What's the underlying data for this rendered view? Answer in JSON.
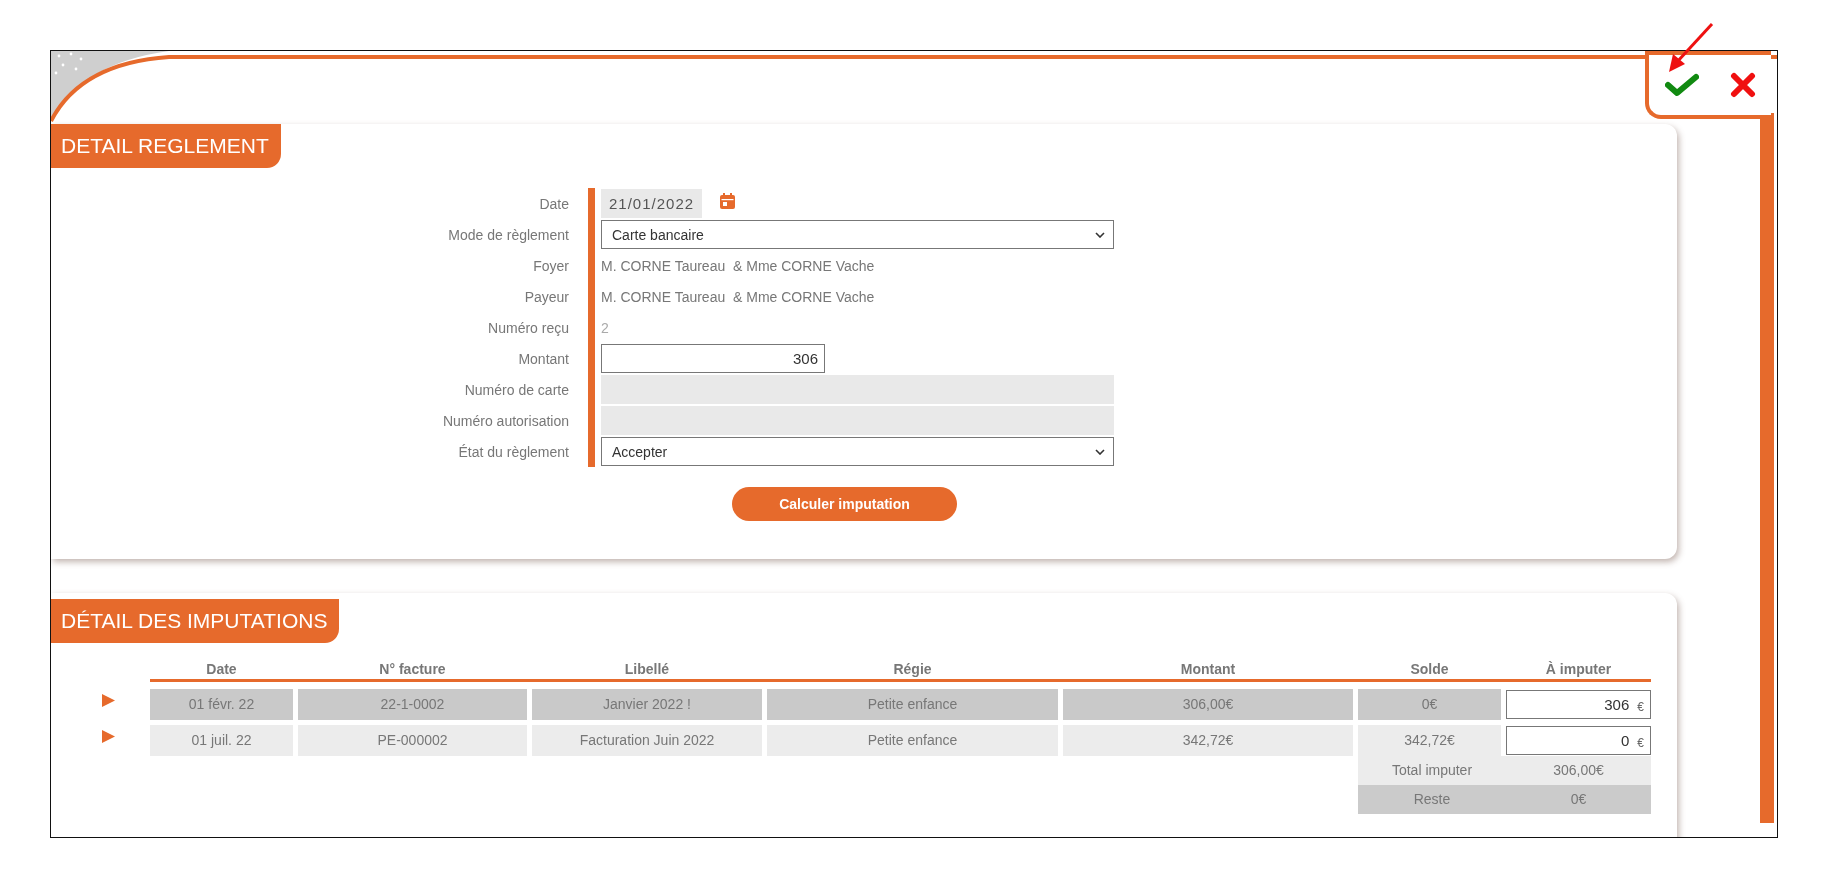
{
  "payment": {
    "title": "DETAIL REGLEMENT",
    "fields": [
      {
        "kind": "date",
        "label": "Date",
        "value": "21/01/2022"
      },
      {
        "kind": "select",
        "label": "Mode de règlement",
        "value": "Carte bancaire"
      },
      {
        "kind": "text",
        "label": "Foyer",
        "value": "M. CORNE Taureau  & Mme CORNE Vache"
      },
      {
        "kind": "text",
        "label": "Payeur",
        "value": "M. CORNE Taureau  & Mme CORNE Vache"
      },
      {
        "kind": "muted",
        "label": "Numéro reçu",
        "value": "2"
      },
      {
        "kind": "input",
        "label": "Montant",
        "value": "306"
      },
      {
        "kind": "disabled",
        "label": "Numéro de carte"
      },
      {
        "kind": "disabled",
        "label": "Numéro autorisation"
      },
      {
        "kind": "select",
        "label": "État du règlement",
        "value": "Accepter"
      }
    ],
    "button": "Calculer imputation"
  },
  "imputations": {
    "title": "DÉTAIL DES IMPUTATIONS",
    "columns": [
      "Date",
      "N° facture",
      "Libellé",
      "Régie",
      "Montant",
      "Solde",
      "À imputer"
    ],
    "rows": [
      {
        "cells": [
          "01 févr. 22",
          "22-1-0002",
          "Janvier 2022 !",
          "Petite enfance",
          "306,00€",
          "0€"
        ],
        "to_impute": "306",
        "currency": "€"
      },
      {
        "cells": [
          "01 juil. 22",
          "PE-000002",
          "Facturation Juin 2022",
          "Petite enfance",
          "342,72€",
          "342,72€"
        ],
        "to_impute": "0",
        "currency": "€"
      }
    ],
    "summary": [
      {
        "label": "Total imputer",
        "value": "306,00€"
      },
      {
        "label": "Reste",
        "value": "0€"
      }
    ]
  }
}
